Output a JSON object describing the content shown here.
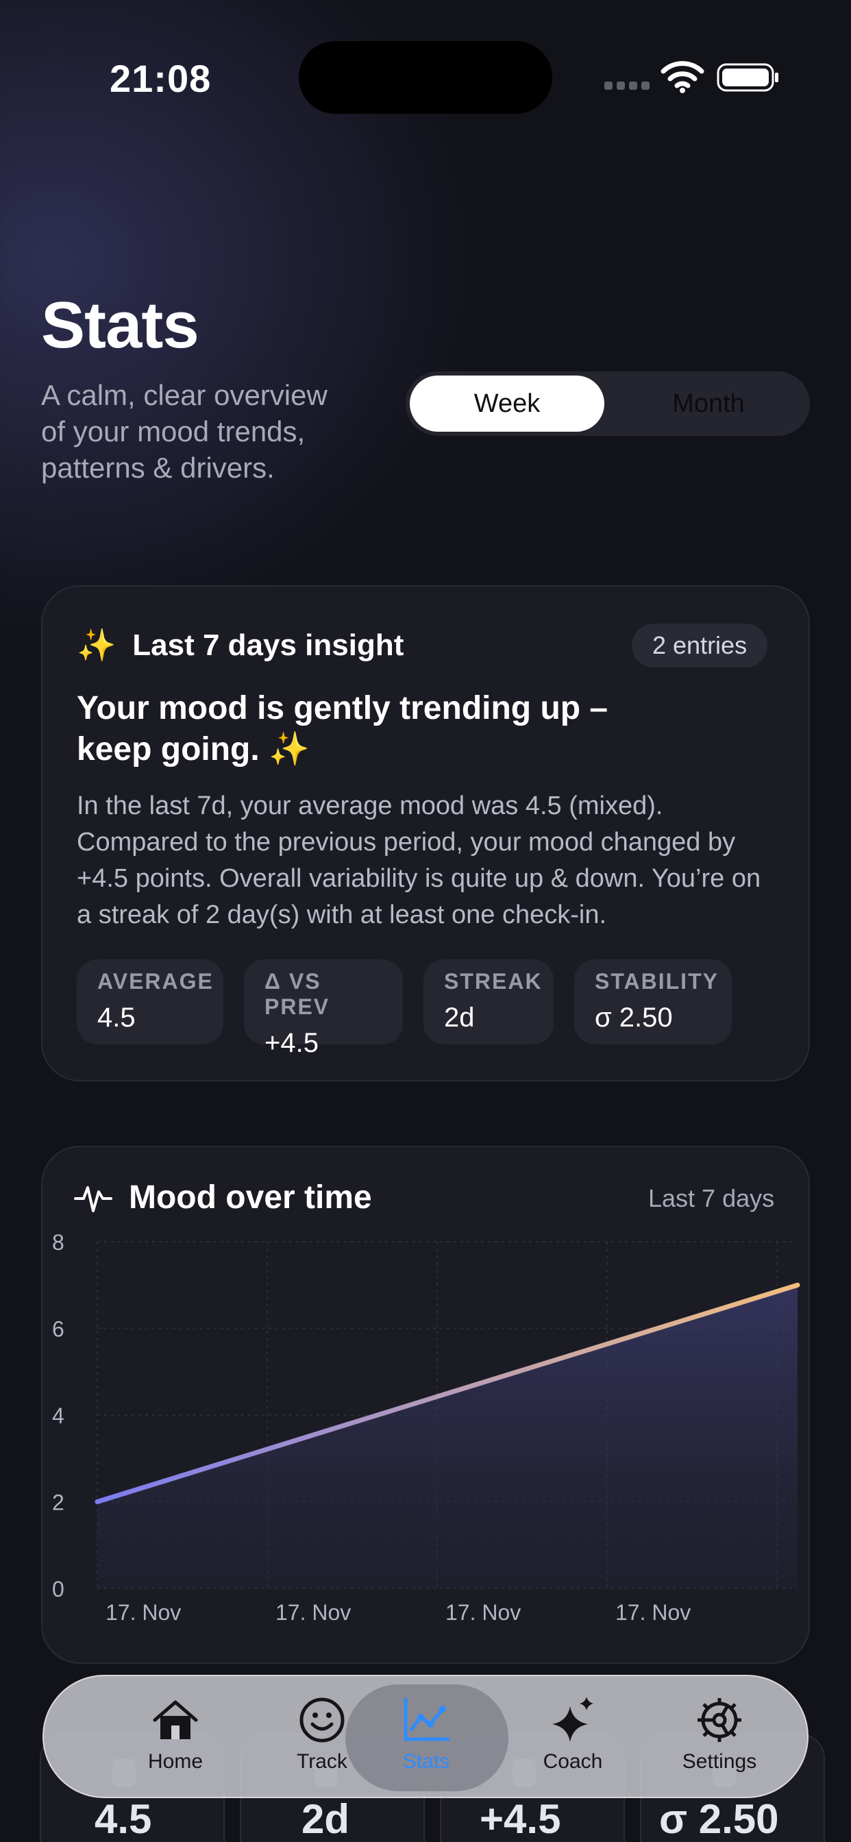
{
  "status_bar": {
    "time": "21:08"
  },
  "header": {
    "title": "Stats",
    "subtitle": "A calm, clear overview of your mood trends, patterns & drivers.",
    "period_toggle": {
      "options": [
        "Week",
        "Month"
      ],
      "selected": "Week"
    }
  },
  "insight": {
    "heading": "Last 7 days insight",
    "heading_emoji": "✨",
    "entries": "2 entries",
    "title": "Your mood is gently trending up – keep going.",
    "title_emoji": "✨",
    "body": "In the last 7d, your average mood was 4.5 (mixed). Compared to the previous period, your mood changed by +4.5 points. Overall variability is quite up & down. You’re on a streak of 2 day(s) with at least one check-in.",
    "stats": [
      {
        "label": "AVERAGE",
        "value": "4.5"
      },
      {
        "label": "Δ VS PREV",
        "value": "+4.5"
      },
      {
        "label": "STREAK",
        "value": "2d"
      },
      {
        "label": "STABILITY",
        "value": "σ 2.50"
      }
    ]
  },
  "mood_chart": {
    "heading": "Mood over time",
    "range_label": "Last 7 days",
    "icon": "pulse-icon"
  },
  "chart_data": {
    "type": "area",
    "title": "Mood over time",
    "x": [
      "17. Nov",
      "17. Nov"
    ],
    "series": [
      {
        "values": [
          2,
          7
        ]
      }
    ],
    "x_tick_labels": [
      "17. Nov",
      "17. Nov",
      "17. Nov",
      "17. Nov"
    ],
    "y_ticks": [
      0,
      2,
      4,
      6,
      8
    ],
    "ylim": [
      0,
      8
    ],
    "grid": true,
    "line_gradient": [
      "#7c7cf0",
      "#f2bd7e"
    ]
  },
  "peek_stats": [
    "4.5",
    "2d",
    "+4.5",
    "σ 2.50"
  ],
  "tab_bar": {
    "items": [
      {
        "label": "Home",
        "icon": "home-icon"
      },
      {
        "label": "Track",
        "icon": "smiley-icon"
      },
      {
        "label": "Stats",
        "icon": "chart-icon",
        "active": true
      },
      {
        "label": "Coach",
        "icon": "sparkles-icon"
      },
      {
        "label": "Settings",
        "icon": "gear-icon"
      }
    ],
    "active_color": "#2f8cff"
  }
}
